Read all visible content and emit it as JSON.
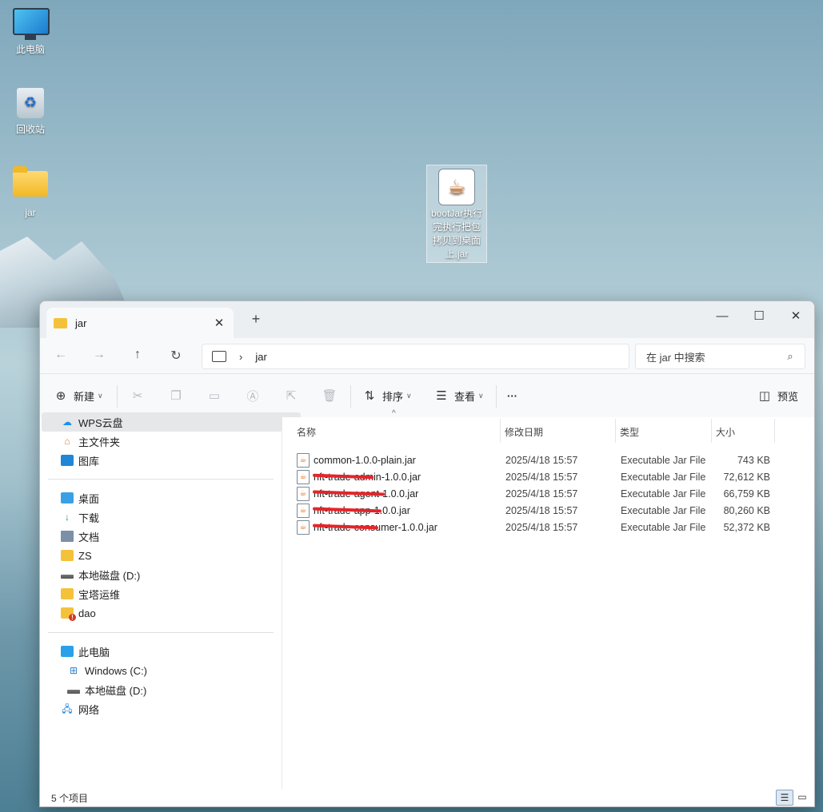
{
  "desktop": {
    "icons": [
      {
        "label": "此电脑",
        "icon": "computer-icon"
      },
      {
        "label": "回收站",
        "icon": "recycle-bin-icon"
      },
      {
        "label": "jar",
        "icon": "folder-icon"
      }
    ],
    "java_file": {
      "label": "bootJar执行完执行把包拷贝到桌面上.jar",
      "icon": "java-jar-icon"
    }
  },
  "window": {
    "tab_label": "jar",
    "new_tab": "+",
    "controls": {
      "minimize": "—",
      "maximize": "☐",
      "close": "✕"
    }
  },
  "address": {
    "path": "jar",
    "search_placeholder": "在 jar 中搜索"
  },
  "toolbar": {
    "new_label": "新建",
    "sort_label": "排序",
    "view_label": "查看",
    "more_label": "···",
    "preview_label": "预览"
  },
  "nav": {
    "group1": [
      {
        "label": "WPS云盘",
        "icon": "cloud-icon",
        "selected": true
      },
      {
        "label": "主文件夹",
        "icon": "home-icon"
      },
      {
        "label": "图库",
        "icon": "gallery-icon"
      }
    ],
    "group2": [
      {
        "label": "桌面",
        "icon": "desktop-icon",
        "pinned": true
      },
      {
        "label": "下载",
        "icon": "download-icon",
        "pinned": true
      },
      {
        "label": "文档",
        "icon": "document-icon",
        "pinned": true
      },
      {
        "label": "ZS",
        "icon": "folder-icon"
      },
      {
        "label": "本地磁盘 (D:)",
        "icon": "drive-icon"
      },
      {
        "label": "宝塔运维",
        "icon": "folder-icon"
      },
      {
        "label": "dao",
        "icon": "folder-warning-icon"
      }
    ],
    "group3": [
      {
        "label": "此电脑",
        "icon": "pc-icon"
      },
      {
        "label": "Windows (C:)",
        "icon": "windows-drive-icon"
      },
      {
        "label": "本地磁盘 (D:)",
        "icon": "drive-icon"
      },
      {
        "label": "网络",
        "icon": "network-icon"
      }
    ]
  },
  "columns": {
    "name": "名称",
    "date": "修改日期",
    "type": "类型",
    "size": "大小"
  },
  "files": [
    {
      "name": "common-1.0.0-plain.jar",
      "date": "2025/4/18 15:57",
      "type": "Executable Jar File",
      "size": "743 KB"
    },
    {
      "name": "nft-trade-admin-1.0.0.jar",
      "date": "2025/4/18 15:57",
      "type": "Executable Jar File",
      "size": "72,612 KB"
    },
    {
      "name": "nft-trade-agent-1.0.0.jar",
      "date": "2025/4/18 15:57",
      "type": "Executable Jar File",
      "size": "66,759 KB"
    },
    {
      "name": "nft-trade-app-1.0.0.jar",
      "date": "2025/4/18 15:57",
      "type": "Executable Jar File",
      "size": "80,260 KB"
    },
    {
      "name": "nft-trade-consumer-1.0.0.jar",
      "date": "2025/4/18 15:57",
      "type": "Executable Jar File",
      "size": "52,372 KB"
    }
  ],
  "status": {
    "count": "5 个项目"
  },
  "colors": {
    "redaction": "#e3252a",
    "selection": "#e5e7e9",
    "folder": "#f4c23a"
  }
}
